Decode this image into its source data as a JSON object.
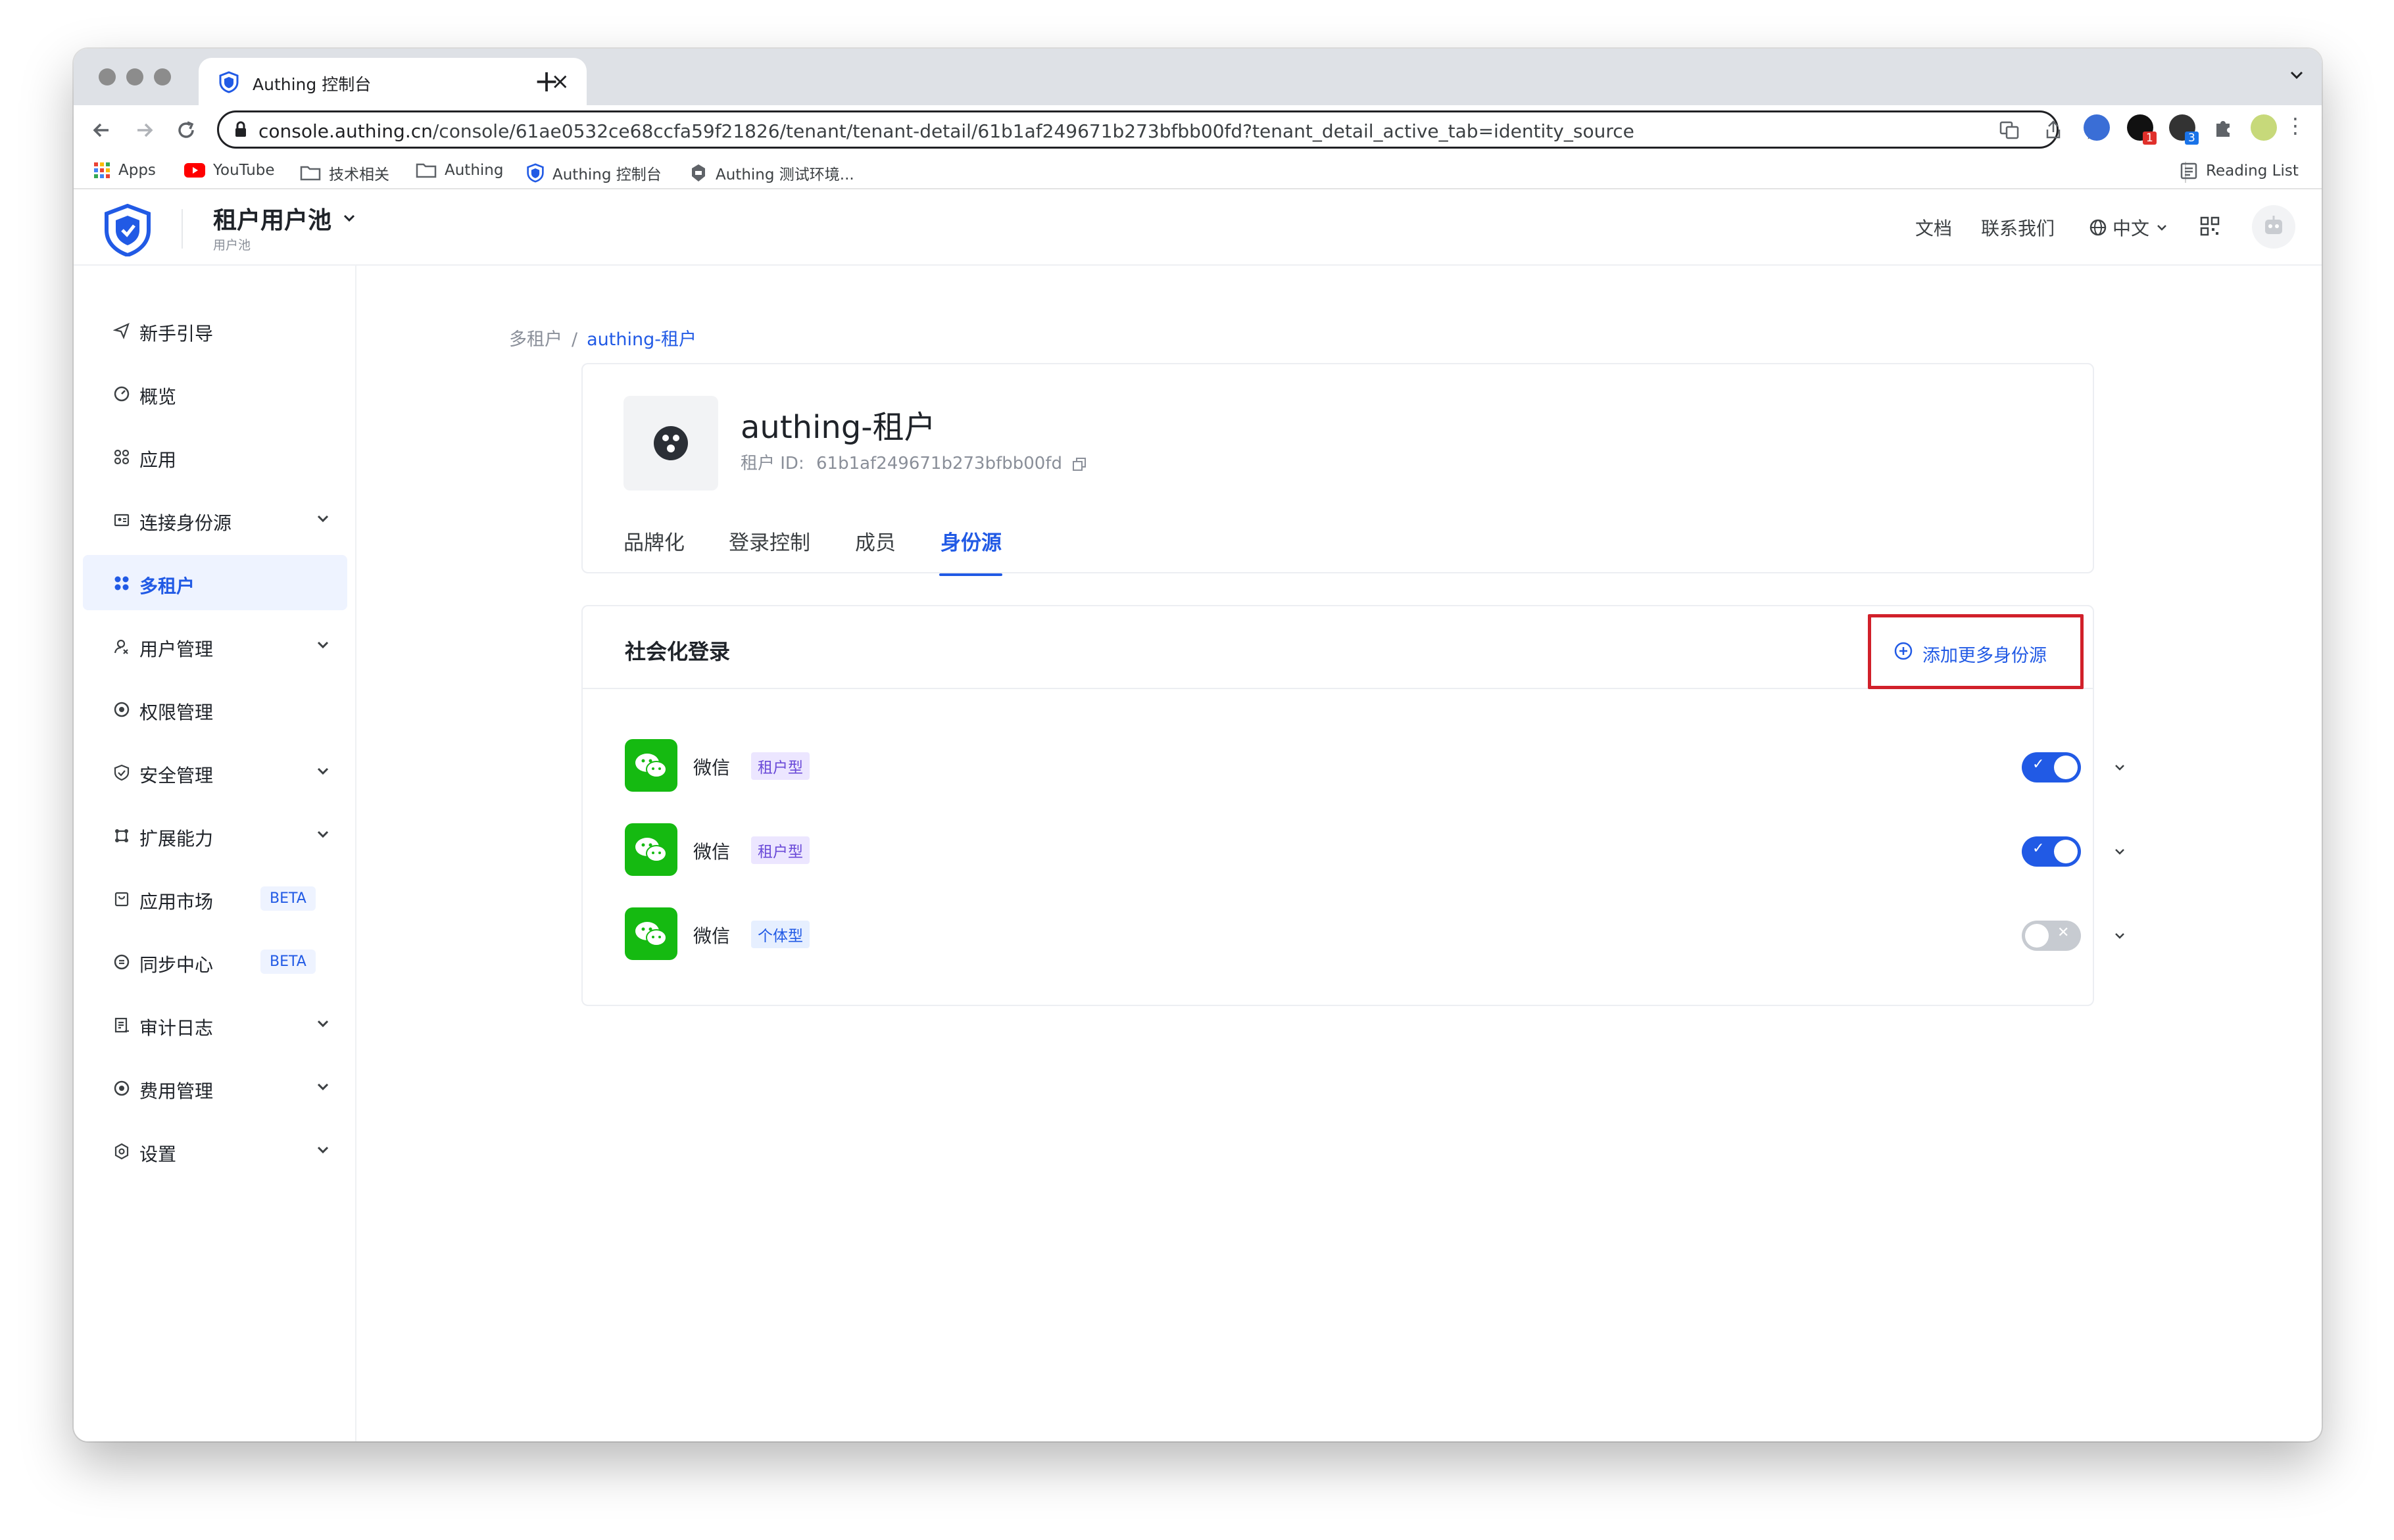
{
  "browser": {
    "tab_title": "Authing 控制台",
    "url_host": "console.authing.cn",
    "url_path": "/console/61ae0532ce68ccfa59f21826/tenant/tenant-detail/61b1af249671b273bfbb00fd?tenant_detail_active_tab=identity_source",
    "bookmarks": [
      "Apps",
      "YouTube",
      "技术相关",
      "Authing",
      "Authing 控制台",
      "Authing 测试环境..."
    ],
    "reading_list": "Reading List",
    "ext_badges": [
      "1",
      "3"
    ]
  },
  "header": {
    "pool_name": "租户用户池",
    "pool_sub": "用户池",
    "links": {
      "docs": "文档",
      "contact": "联系我们",
      "language": "中文"
    }
  },
  "sidebar": {
    "items": [
      {
        "label": "新手引导",
        "icon": "send-icon",
        "expand": false
      },
      {
        "label": "概览",
        "icon": "gauge-icon",
        "expand": false
      },
      {
        "label": "应用",
        "icon": "apps-icon",
        "expand": false
      },
      {
        "label": "连接身份源",
        "icon": "id-card-icon",
        "expand": true
      },
      {
        "label": "多租户",
        "icon": "grid-icon",
        "expand": false,
        "active": true
      },
      {
        "label": "用户管理",
        "icon": "user-icon",
        "expand": true
      },
      {
        "label": "权限管理",
        "icon": "at-icon",
        "expand": false
      },
      {
        "label": "安全管理",
        "icon": "shield-icon",
        "expand": true
      },
      {
        "label": "扩展能力",
        "icon": "extend-icon",
        "expand": true
      },
      {
        "label": "应用市场",
        "icon": "market-icon",
        "expand": false,
        "badge": "BETA"
      },
      {
        "label": "同步中心",
        "icon": "sync-icon",
        "expand": false,
        "badge": "BETA"
      },
      {
        "label": "审计日志",
        "icon": "log-icon",
        "expand": true
      },
      {
        "label": "费用管理",
        "icon": "coin-icon",
        "expand": true
      },
      {
        "label": "设置",
        "icon": "gear-icon",
        "expand": true
      }
    ]
  },
  "breadcrumb": {
    "parent": "多租户",
    "separator": "/",
    "current": "authing-租户"
  },
  "tenant": {
    "name": "authing-租户",
    "id_label": "租户 ID:",
    "id_value": "61b1af249671b273bfbb00fd",
    "tabs": [
      "品牌化",
      "登录控制",
      "成员",
      "身份源"
    ],
    "active_tab": "身份源"
  },
  "identity_sources": {
    "section_title": "社会化登录",
    "add_button": "添加更多身份源",
    "rows": [
      {
        "name": "微信",
        "tag": "租户型",
        "tag_color": "purple",
        "enabled": true,
        "mark": "✓"
      },
      {
        "name": "微信",
        "tag": "租户型",
        "tag_color": "purple",
        "enabled": true,
        "mark": "✓"
      },
      {
        "name": "微信",
        "tag": "个体型",
        "tag_color": "blue",
        "enabled": false,
        "mark": "✕"
      }
    ]
  },
  "colors": {
    "accent": "#215ae5",
    "wechat": "#15ba11",
    "highlight_box": "#d1202a"
  }
}
